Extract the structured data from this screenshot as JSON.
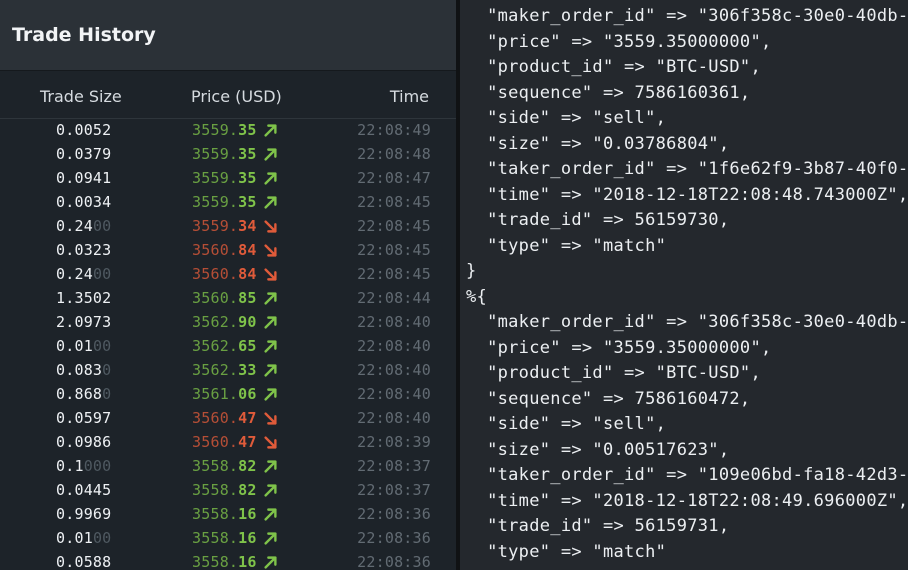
{
  "trade_history": {
    "title": "Trade History",
    "columns": {
      "size": "Trade Size",
      "price": "Price (USD)",
      "time": "Time"
    },
    "colors": {
      "up": "#7fc34a",
      "down": "#e05b3a"
    },
    "rows": [
      {
        "size": "0.0052",
        "size_pad": "",
        "price": "3559.35",
        "dir": "up",
        "time": "22:08:49"
      },
      {
        "size": "0.0379",
        "size_pad": "",
        "price": "3559.35",
        "dir": "up",
        "time": "22:08:48"
      },
      {
        "size": "0.0941",
        "size_pad": "",
        "price": "3559.35",
        "dir": "up",
        "time": "22:08:47"
      },
      {
        "size": "0.0034",
        "size_pad": "",
        "price": "3559.35",
        "dir": "up",
        "time": "22:08:45"
      },
      {
        "size": "0.24",
        "size_pad": "00",
        "price": "3559.34",
        "dir": "down",
        "time": "22:08:45"
      },
      {
        "size": "0.0323",
        "size_pad": "",
        "price": "3560.84",
        "dir": "down",
        "time": "22:08:45"
      },
      {
        "size": "0.24",
        "size_pad": "00",
        "price": "3560.84",
        "dir": "down",
        "time": "22:08:45"
      },
      {
        "size": "1.3502",
        "size_pad": "",
        "price": "3560.85",
        "dir": "up",
        "time": "22:08:44"
      },
      {
        "size": "2.0973",
        "size_pad": "",
        "price": "3562.90",
        "dir": "up",
        "time": "22:08:40"
      },
      {
        "size": "0.01",
        "size_pad": "00",
        "price": "3562.65",
        "dir": "up",
        "time": "22:08:40"
      },
      {
        "size": "0.083",
        "size_pad": "0",
        "price": "3562.33",
        "dir": "up",
        "time": "22:08:40"
      },
      {
        "size": "0.868",
        "size_pad": "0",
        "price": "3561.06",
        "dir": "up",
        "time": "22:08:40"
      },
      {
        "size": "0.0597",
        "size_pad": "",
        "price": "3560.47",
        "dir": "down",
        "time": "22:08:40"
      },
      {
        "size": "0.0986",
        "size_pad": "",
        "price": "3560.47",
        "dir": "down",
        "time": "22:08:39"
      },
      {
        "size": "0.1",
        "size_pad": "000",
        "price": "3558.82",
        "dir": "up",
        "time": "22:08:37"
      },
      {
        "size": "0.0445",
        "size_pad": "",
        "price": "3558.82",
        "dir": "up",
        "time": "22:08:37"
      },
      {
        "size": "0.9969",
        "size_pad": "",
        "price": "3558.16",
        "dir": "up",
        "time": "22:08:36"
      },
      {
        "size": "0.01",
        "size_pad": "00",
        "price": "3558.16",
        "dir": "up",
        "time": "22:08:36"
      },
      {
        "size": "0.0588",
        "size_pad": "",
        "price": "3558.16",
        "dir": "up",
        "time": "22:08:36"
      }
    ]
  },
  "terminal": {
    "lines": [
      "  \"maker_order_id\" => \"306f358c-30e0-40db-",
      "  \"price\" => \"3559.35000000\",",
      "  \"product_id\" => \"BTC-USD\",",
      "  \"sequence\" => 7586160361,",
      "  \"side\" => \"sell\",",
      "  \"size\" => \"0.03786804\",",
      "  \"taker_order_id\" => \"1f6e62f9-3b87-40f0-",
      "  \"time\" => \"2018-12-18T22:08:48.743000Z\",",
      "  \"trade_id\" => 56159730,",
      "  \"type\" => \"match\"",
      "}",
      "%{",
      "  \"maker_order_id\" => \"306f358c-30e0-40db-",
      "  \"price\" => \"3559.35000000\",",
      "  \"product_id\" => \"BTC-USD\",",
      "  \"sequence\" => 7586160472,",
      "  \"side\" => \"sell\",",
      "  \"size\" => \"0.00517623\",",
      "  \"taker_order_id\" => \"109e06bd-fa18-42d3-",
      "  \"time\" => \"2018-12-18T22:08:49.696000Z\",",
      "  \"trade_id\" => 56159731,",
      "  \"type\" => \"match\""
    ]
  }
}
